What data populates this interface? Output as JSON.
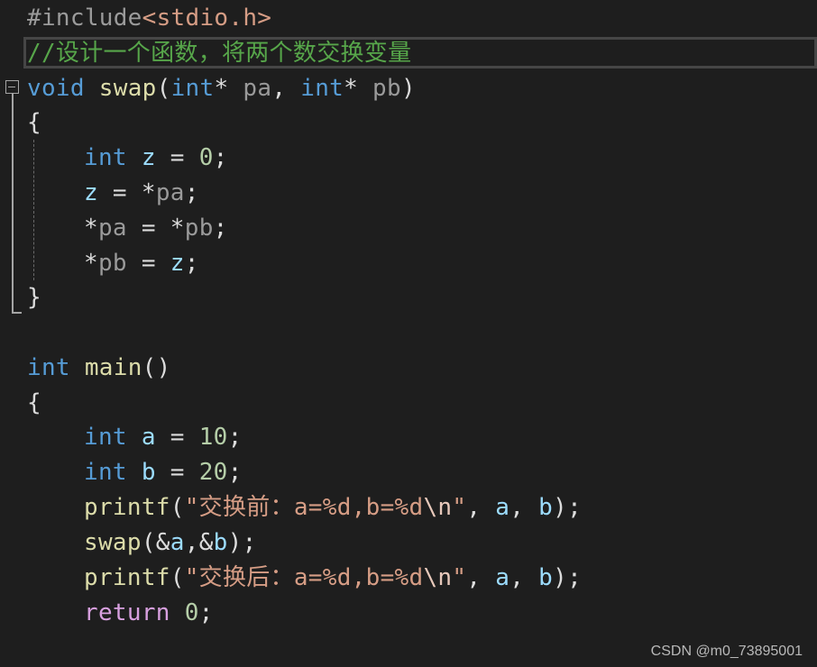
{
  "colors": {
    "background": "#1e1e1e",
    "preprocessor": "#9b9b9b",
    "include_path": "#d69d85",
    "comment": "#57a64a",
    "keyword": "#569cd6",
    "control_keyword": "#d8a0df",
    "function": "#dcdcaa",
    "parameter": "#9a9a9a",
    "variable": "#9cdcfe",
    "string": "#d69d85",
    "number": "#b5cea8",
    "punctuation": "#dcdcdc"
  },
  "icons": {
    "fold": "collapse-minus-icon"
  },
  "code": {
    "line1": {
      "directive": "#include",
      "path": "<stdio.h>"
    },
    "line2": {
      "comment": "//设计一个函数，将两个数交换变量"
    },
    "line3": {
      "ret_type": "void",
      "fn_name": "swap",
      "open": "(",
      "p1_type": "int",
      "p1_star": "* ",
      "p1_name": "pa",
      "sep": ", ",
      "p2_type": "int",
      "p2_star": "* ",
      "p2_name": "pb",
      "close": ")"
    },
    "line4": {
      "brace": "{"
    },
    "line5": {
      "type": "int",
      "var": "z",
      "eq": " = ",
      "num": "0",
      "semi": ";"
    },
    "line6": {
      "var": "z",
      "eq": " = ",
      "star": "*",
      "param": "pa",
      "semi": ";"
    },
    "line7": {
      "star1": "*",
      "param1": "pa",
      "eq": " = ",
      "star2": "*",
      "param2": "pb",
      "semi": ";"
    },
    "line8": {
      "star": "*",
      "param": "pb",
      "eq": " = ",
      "var": "z",
      "semi": ";"
    },
    "line9": {
      "brace": "}"
    },
    "line10": {
      "ret_type": "int",
      "fn_name": "main",
      "parens": "()"
    },
    "line11": {
      "brace": "{"
    },
    "line12": {
      "type": "int",
      "var": "a",
      "eq": " = ",
      "num": "10",
      "semi": ";"
    },
    "line13": {
      "type": "int",
      "var": "b",
      "eq": " = ",
      "num": "20",
      "semi": ";"
    },
    "line14": {
      "fn_name": "printf",
      "open": "(",
      "str": "\"交换前：a=%d,b=%d",
      "esc": "\\n",
      "str_end": "\"",
      "sep1": ", ",
      "arg1": "a",
      "sep2": ", ",
      "arg2": "b",
      "close": ");"
    },
    "line15": {
      "fn_name": "swap",
      "open": "(",
      "amp1": "&",
      "arg1": "a",
      "comma": ",",
      "amp2": "&",
      "arg2": "b",
      "close": ");"
    },
    "line16": {
      "fn_name": "printf",
      "open": "(",
      "str": "\"交换后：a=%d,b=%d",
      "esc": "\\n",
      "str_end": "\"",
      "sep1": ", ",
      "arg1": "a",
      "sep2": ", ",
      "arg2": "b",
      "close": ");"
    },
    "line17": {
      "keyword": "return",
      "space": " ",
      "num": "0",
      "semi": ";"
    }
  },
  "watermark": "CSDN @m0_73895001"
}
